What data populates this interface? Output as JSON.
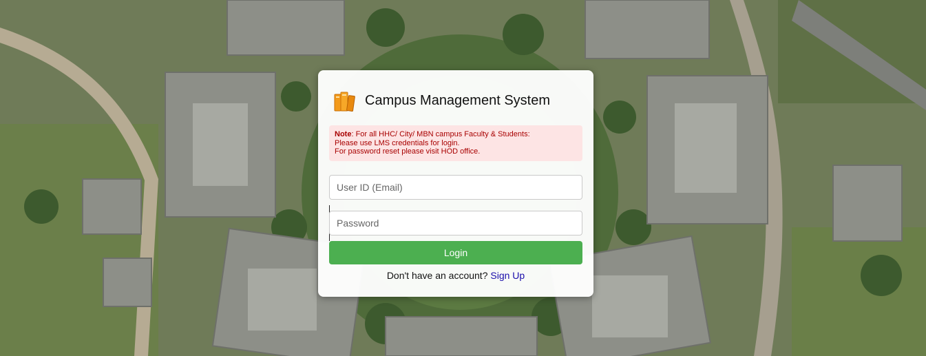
{
  "background": {
    "description_icon": "aerial-campus-photo"
  },
  "login_card": {
    "logo_icon": "books-icon",
    "title": "Campus Management System",
    "note": {
      "label": "Note",
      "line1": ": For all HHC/ City/ MBN campus Faculty & Students:",
      "line2": "Please use LMS credentials for login.",
      "line3": "For password reset please visit HOD office."
    },
    "user_id": {
      "placeholder": "User ID (Email)",
      "value": ""
    },
    "password": {
      "placeholder": "Password",
      "value": ""
    },
    "login_label": "Login",
    "signup_prompt": "Don't have an account?",
    "signup_label": "Sign Up"
  },
  "colors": {
    "primary_button": "#4caf50",
    "note_background": "#fde4e4",
    "note_text": "#a80000",
    "link": "#1a0dab"
  }
}
